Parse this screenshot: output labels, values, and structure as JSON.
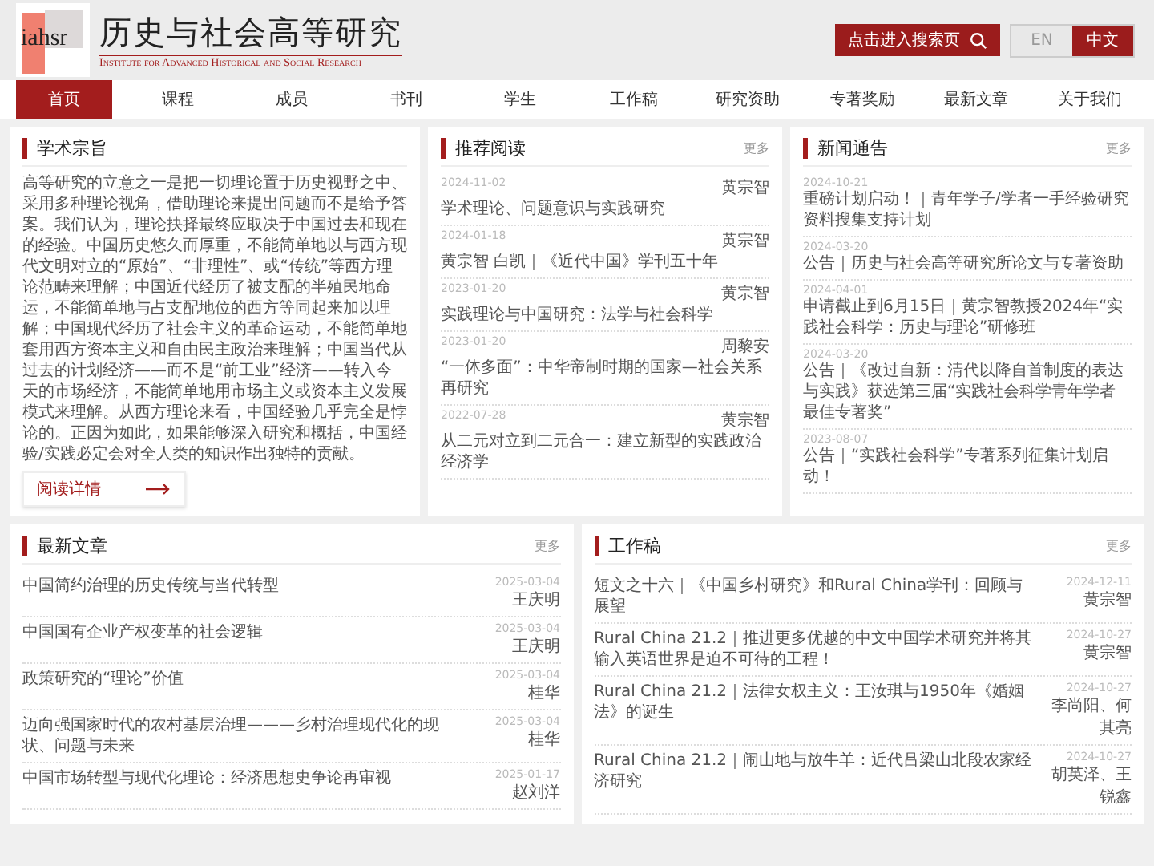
{
  "header": {
    "logo_mark": "iahsr",
    "title": "历史与社会高等研究",
    "subtitle": "Institute for Advanced Historical and Social Research",
    "search_button": "点击进入搜索页",
    "languages": [
      {
        "label": "EN",
        "selected": false
      },
      {
        "label": "中文",
        "selected": true
      }
    ]
  },
  "nav": [
    {
      "label": "首页",
      "selected": true
    },
    {
      "label": "课程",
      "selected": false
    },
    {
      "label": "成员",
      "selected": false
    },
    {
      "label": "书刊",
      "selected": false
    },
    {
      "label": "学生",
      "selected": false
    },
    {
      "label": "工作稿",
      "selected": false
    },
    {
      "label": "研究资助",
      "selected": false
    },
    {
      "label": "专著奖励",
      "selected": false
    },
    {
      "label": "最新文章",
      "selected": false
    },
    {
      "label": "关于我们",
      "selected": false
    }
  ],
  "mission": {
    "title": "学术宗旨",
    "text": "高等研究的立意之一是把一切理论置于历史视野之中、采用多种理论视角，借助理论来提出问题而不是给予答案。我们认为，理论抉择最终应取决于中国过去和现在的经验。中国历史悠久而厚重，不能简单地以与西方现代文明对立的“原始”、“非理性”、或“传统”等西方理论范畴来理解；中国近代经历了被支配的半殖民地命运，不能简单地与占支配地位的西方等同起来加以理解；中国现代经历了社会主义的革命运动，不能简单地套用西方资本主义和自由民主政治来理解；中国当代从过去的计划经济——而不是“前工业”经济——转入今天的市场经济，不能简单地用市场主义或资本主义发展模式来理解。从西方理论来看，中国经验几乎完全是悖论的。正因为如此，如果能够深入研究和概括，中国经验/实践必定会对全人类的知识作出独特的贡献。",
    "button": "阅读详情"
  },
  "recommended": {
    "title": "推荐阅读",
    "more": "更多",
    "items": [
      {
        "date": "2024-11-02",
        "author": "黄宗智",
        "title": "学术理论、问题意识与实践研究"
      },
      {
        "date": "2024-01-18",
        "author": "黄宗智",
        "title": "黄宗智 白凯｜《近代中国》学刊五十年"
      },
      {
        "date": "2023-01-20",
        "author": "黄宗智",
        "title": "实践理论与中国研究：法学与社会科学"
      },
      {
        "date": "2023-01-20",
        "author": "周黎安",
        "title": "“一体多面”：中华帝制时期的国家—社会关系再研究"
      },
      {
        "date": "2022-07-28",
        "author": "黄宗智",
        "title": "从二元对立到二元合一：建立新型的实践政治经济学"
      }
    ]
  },
  "news": {
    "title": "新闻通告",
    "more": "更多",
    "items": [
      {
        "date": "2024-10-21",
        "title": "重磅计划启动！｜青年学子/学者一手经验研究资料搜集支持计划"
      },
      {
        "date": "2024-03-20",
        "title": "公告｜历史与社会高等研究所论文与专著资助"
      },
      {
        "date": "2024-04-01",
        "title": "申请截止到6月15日｜黄宗智教授2024年“实践社会科学：历史与理论”研修班"
      },
      {
        "date": "2024-03-20",
        "title": "公告｜《改过自新：清代以降自首制度的表达与实践》获选第三届“实践社会科学青年学者最佳专著奖”"
      },
      {
        "date": "2023-08-07",
        "title": "公告｜“实践社会科学”专著系列征集计划启动！"
      }
    ]
  },
  "latest": {
    "title": "最新文章",
    "more": "更多",
    "items": [
      {
        "title": "中国简约治理的历史传统与当代转型",
        "date": "2025-03-04",
        "author": "王庆明"
      },
      {
        "title": "中国国有企业产权变革的社会逻辑",
        "date": "2025-03-04",
        "author": "王庆明"
      },
      {
        "title": "政策研究的“理论”价值",
        "date": "2025-03-04",
        "author": "桂华"
      },
      {
        "title": "迈向强国家时代的农村基层治理———乡村治理现代化的现状、问题与未来",
        "date": "2025-03-04",
        "author": "桂华"
      },
      {
        "title": "中国市场转型与现代化理论：经济思想史争论再审视",
        "date": "2025-01-17",
        "author": "赵刘洋"
      }
    ]
  },
  "papers": {
    "title": "工作稿",
    "more": "更多",
    "items": [
      {
        "title": "短文之十六｜《中国乡村研究》和Rural China学刊：回顾与展望",
        "date": "2024-12-11",
        "author": "黄宗智"
      },
      {
        "title": "Rural China 21.2｜推进更多优越的中文中国学术研究并将其输入英语世界是迫不可待的工程！",
        "date": "2024-10-27",
        "author": "黄宗智"
      },
      {
        "title": "Rural China 21.2｜法律女权主义：王汝琪与1950年《婚姻法》的诞生",
        "date": "2024-10-27",
        "author": "李尚阳、何其亮"
      },
      {
        "title": "Rural China 21.2｜闹山地与放牛羊：近代吕梁山北段农家经济研究",
        "date": "2024-10-27",
        "author": "胡英泽、王锐鑫"
      }
    ]
  }
}
